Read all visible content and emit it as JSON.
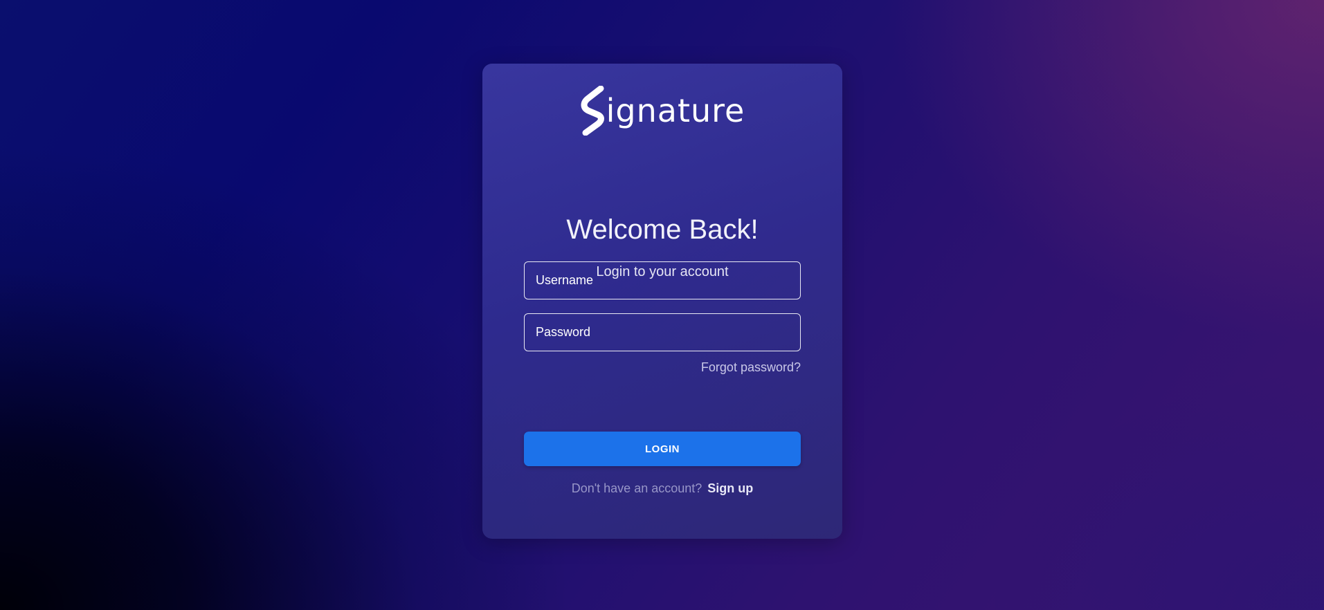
{
  "brand": {
    "logo_text": "ignature",
    "logo_mark": "signature-s-icon"
  },
  "heading": {
    "title": "Welcome Back!",
    "subtitle": "Login to your account"
  },
  "form": {
    "username_placeholder": "Username",
    "password_placeholder": "Password",
    "username_value": "",
    "password_value": "",
    "forgot_label": "Forgot password?",
    "login_label": "LOGIN"
  },
  "footer": {
    "prompt": "Don't have an account?",
    "signup_label": "Sign up"
  },
  "colors": {
    "accent": "#1c72ea",
    "card": "#3a389e",
    "background_dark": "#000008",
    "background_purple": "#6e286e"
  }
}
